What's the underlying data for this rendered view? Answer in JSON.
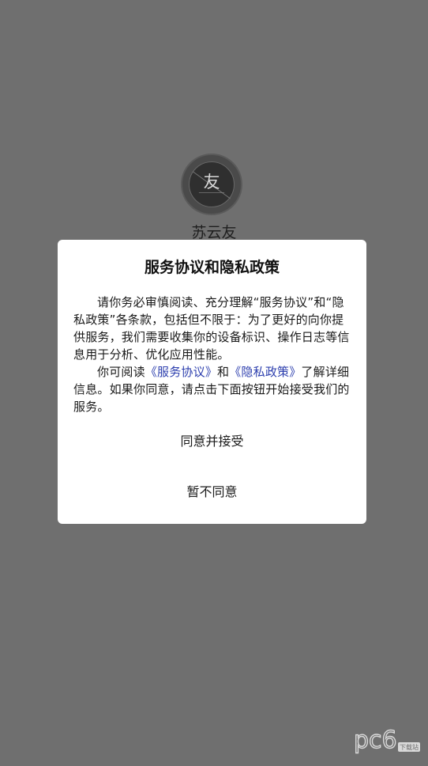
{
  "app": {
    "name": "苏云友",
    "logo_char": "友"
  },
  "dialog": {
    "title": "服务协议和隐私政策",
    "para1": "请你务必审慎阅读、充分理解“服务协议”和“隐私政策”各条款，包括但不限于：为了更好的向你提供服务，我们需要收集你的设备标识、操作日志等信息用于分析、优化应用性能。",
    "para2_prefix": "你可阅读",
    "link_service": "《服务协议》",
    "para2_and": "和",
    "link_privacy": "《隐私政策》",
    "para2_suffix": "了解详细信息。如果你同意，请点击下面按钮开始接受我们的服务。",
    "agree_label": "同意并接受",
    "decline_label": "暂不同意"
  },
  "watermark": {
    "text": "pc6",
    "sub": "下载站"
  },
  "colors": {
    "overlay": "#6f6f6f",
    "link": "#2d3fae",
    "dialog_bg": "#ffffff"
  }
}
